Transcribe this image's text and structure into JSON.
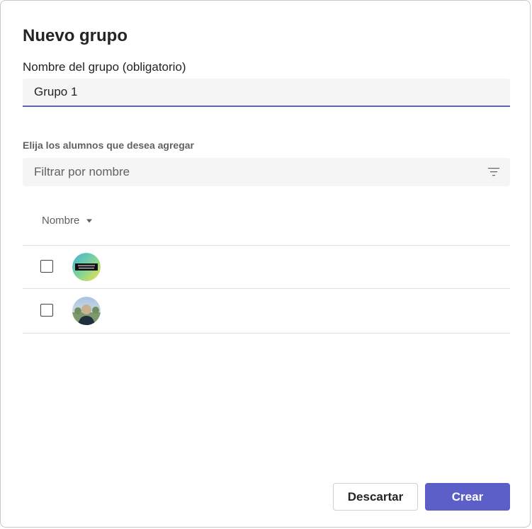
{
  "dialog": {
    "title": "Nuevo grupo",
    "name_label": "Nombre del grupo (obligatorio)",
    "name_value": "Grupo 1",
    "students_label": "Elija los alumnos que desea agregar",
    "filter_placeholder": "Filtrar por nombre",
    "column_header": "Nombre",
    "students": [
      {
        "checked": false,
        "avatar": "gradient-badge-avatar"
      },
      {
        "checked": false,
        "avatar": "photo-avatar"
      }
    ],
    "discard_label": "Descartar",
    "create_label": "Crear"
  },
  "colors": {
    "accent": "#5b5fc7",
    "field_bg": "#f5f5f5",
    "text": "#242424",
    "muted": "#616161"
  }
}
